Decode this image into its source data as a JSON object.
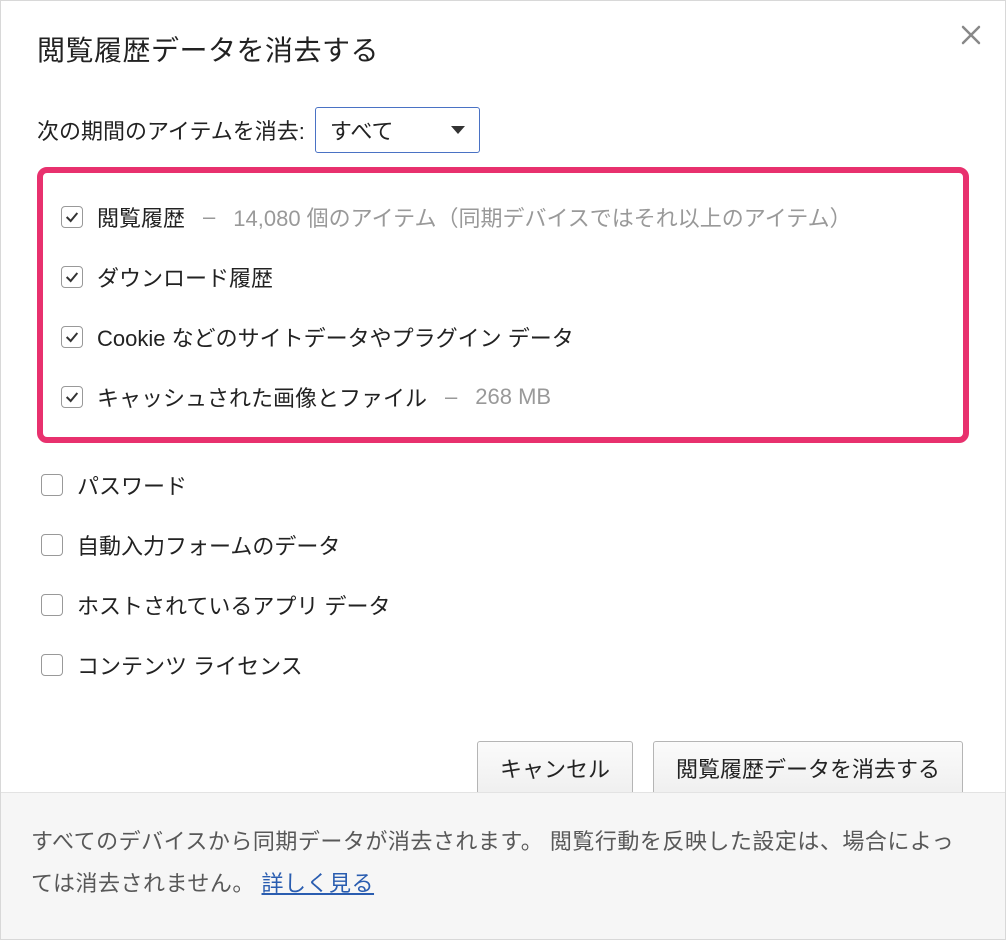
{
  "dialog": {
    "title": "閲覧履歴データを消去する",
    "close_icon": "close-icon"
  },
  "period": {
    "label": "次の期間のアイテムを消去:",
    "selected": "すべて"
  },
  "options": [
    {
      "id": "browsing-history",
      "label": "閲覧履歴",
      "checked": true,
      "meta": "14,080 個のアイテム（同期デバイスではそれ以上のアイテム）",
      "highlighted": true
    },
    {
      "id": "download-history",
      "label": "ダウンロード履歴",
      "checked": true,
      "meta": "",
      "highlighted": true
    },
    {
      "id": "cookies",
      "label": "Cookie などのサイトデータやプラグイン データ",
      "checked": true,
      "meta": "",
      "highlighted": true
    },
    {
      "id": "cached",
      "label": "キャッシュされた画像とファイル",
      "checked": true,
      "meta": "268 MB",
      "highlighted": true
    },
    {
      "id": "passwords",
      "label": "パスワード",
      "checked": false,
      "meta": "",
      "highlighted": false
    },
    {
      "id": "autofill",
      "label": "自動入力フォームのデータ",
      "checked": false,
      "meta": "",
      "highlighted": false
    },
    {
      "id": "hosted-app",
      "label": "ホストされているアプリ データ",
      "checked": false,
      "meta": "",
      "highlighted": false
    },
    {
      "id": "content-licenses",
      "label": "コンテンツ ライセンス",
      "checked": false,
      "meta": "",
      "highlighted": false
    }
  ],
  "buttons": {
    "cancel": "キャンセル",
    "confirm": "閲覧履歴データを消去する"
  },
  "footer": {
    "text": "すべてのデバイスから同期データが消去されます。 閲覧行動を反映した設定は、場合によっては消去されません。 ",
    "link": "詳しく見る"
  }
}
